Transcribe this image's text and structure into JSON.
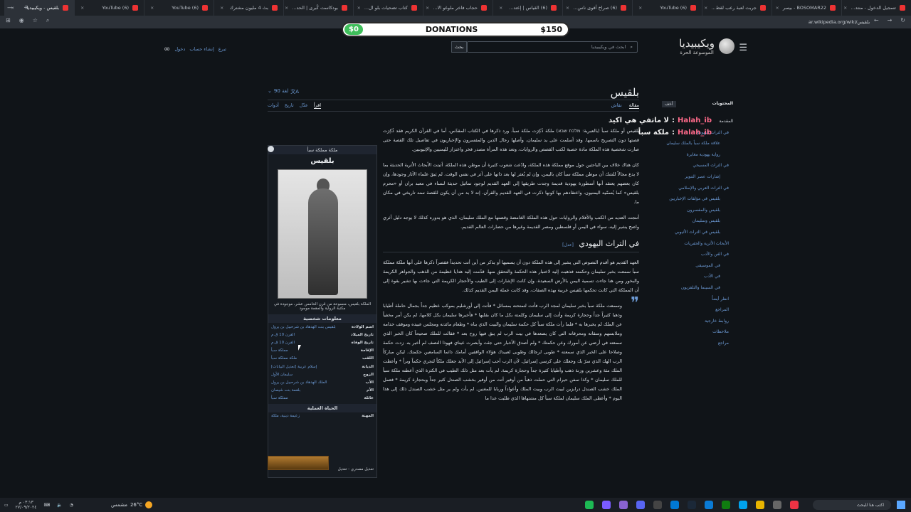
{
  "browser": {
    "tabs": [
      {
        "label": "تسجيل الدخول - منتد..."
      },
      {
        "label": "BOSOMAR22 - بيسر"
      },
      {
        "label": "جربت لعبة رعب لقط..."
      },
      {
        "label": "(6) YouTube"
      },
      {
        "label": "(6) صراخ أقوى ناس..."
      },
      {
        "label": "(6) القياس | إعتد..."
      },
      {
        "label": "حجاب فاخر ملوغو الا..."
      },
      {
        "label": "كتاب تضحيات بلو ال..."
      },
      {
        "label": "بودكاست كُبرى | الحد..."
      },
      {
        "label": "بث 4 مليون مشترك"
      },
      {
        "label": "(6) YouTube"
      },
      {
        "label": "(6) YouTube"
      },
      {
        "label": "بلقيس - ويكيبيديا",
        "active": true
      }
    ],
    "address": "ar.wikipedia.org/wiki/بلقيس"
  },
  "wiki": {
    "logo_title": "ويكيبيديا",
    "logo_sub": "الموسوعة الحرة",
    "search_placeholder": "ابحث في ويكيبيديا",
    "search_button": "بحث",
    "user_links": [
      "تبرع",
      "إنشاء حساب",
      "دخول"
    ],
    "donation": {
      "left": "$0",
      "center": "DONATIONS",
      "right": "$150"
    },
    "title": "بلقيس",
    "lang_count": "90 لغة",
    "tabs_main": [
      "مقالة",
      "نقاش"
    ],
    "tabs_view": [
      "اقرأ",
      "عدّل",
      "تاريخ",
      "أدوات"
    ],
    "toc": {
      "heading": "المحتويات",
      "hide": "أخف",
      "items": [
        {
          "label": "المقدمة",
          "level": 0
        },
        {
          "label": "في التراث اليهودي",
          "level": 1
        },
        {
          "label": "علاقة ملكة سبأ بالملك سليمان",
          "level": 2
        },
        {
          "label": "رواية يهودية مغايرة",
          "level": 2
        },
        {
          "label": "في التراث المسيحي",
          "level": 1
        },
        {
          "label": "إشارات عصر التنوير",
          "level": 2
        },
        {
          "label": "في التراث العربي والإسلامي",
          "level": 1
        },
        {
          "label": "بلقيس في مؤلفات الإخباريين",
          "level": 2
        },
        {
          "label": "بلقيس والمفسرون",
          "level": 2
        },
        {
          "label": "بلقيس وسليمان",
          "level": 2
        },
        {
          "label": "بلقيس في التراث الأثيوبي",
          "level": 2
        },
        {
          "label": "الأبحاث الأثرية والحفريات",
          "level": 1
        },
        {
          "label": "في الفن والأدب",
          "level": 1
        },
        {
          "label": "في الموسيقى",
          "level": 2
        },
        {
          "label": "في الأدب",
          "level": 2
        },
        {
          "label": "في السينما والتلفزيون",
          "level": 2
        },
        {
          "label": "انظر أيضاً",
          "level": 1
        },
        {
          "label": "المراجع",
          "level": 1
        },
        {
          "label": "روابط خارجية",
          "level": 1
        },
        {
          "label": "ملاحظات",
          "level": 1
        },
        {
          "label": "مراجع",
          "level": 1
        }
      ]
    },
    "chat": [
      {
        "nick": "Halah_ib",
        "text": "لا ماتفي هي اكيد"
      },
      {
        "nick": "Halah_ib",
        "text": "ملكة سبأ"
      }
    ],
    "infobox": {
      "header": "ملكة مملكة سبأ",
      "title": "بلقيس",
      "caption": "الملكة بلقيس، منسوخة من قرن الخامس عشر، موجودة في مكتبة الرواية والمقمة موجود",
      "section1": "معلومات شخصية",
      "rows": [
        {
          "k": "اسم الولادة",
          "v": "بلقيس بنت الهدهاد بن شرحبيل بن يرول"
        },
        {
          "k": "تاريخ الميلاد",
          "v": "القرن 10 ق.م"
        },
        {
          "k": "تاريخ الوفاة",
          "v": "القرن 10 ق.م"
        },
        {
          "k": "الإقامة",
          "v": "مملكة سبأ"
        },
        {
          "k": "اللقب",
          "v": "ملكة مملكة سبأ"
        },
        {
          "k": "الديانة",
          "v": "إسلام عربية  [تعديل البيانات]"
        },
        {
          "k": "الزوج",
          "v": "سليمان الأول"
        },
        {
          "k": "الأب",
          "v": "الملك الهدهاد بن شرحبيل بن يرول"
        },
        {
          "k": "الأم",
          "v": "بلقمة بنت شيصان"
        },
        {
          "k": "عائلة",
          "v": "مملكة سبأ"
        }
      ],
      "section2": "الحياة العملية",
      "rows2": [
        {
          "k": "المهنة",
          "v": "زعيمة دينية، ملكة"
        }
      ],
      "footer": "تعديل مصدري - تعديل"
    },
    "article": {
      "p1": "بلقيس أو ملكة سبأ (بالعبرية: מלכת שבא) ملكة ذُكِرَت ملكة سبأ، ورد ذكرها في الكتاب المقدّس، أما في القرآن الكريم فقد ذُكِرَت قصتها دون التصريح باسمها. وقد أسلمت على يد سليمان، وأصلها رجال الدين والمفسرون والإخباريون في تفاصيل تلك القصة حتى صارت شخصية هذه الملكة مادة خصبة لكتب القصص والروايات، وتعد هذه المرأة مصدر فخر واعتزاز لليمنيين والإثيوبيين.",
      "p2": "كان هناك خلاف بين الباحثين حول موقع مملكة هذه الملكة، وادّعت شعوب كثيرة أن موطن هذه الملكة، أثبتت الأبحاث الأثرية الحديثة بما لا يدع مجالاً للشك أن موطن مملكة سبأ كان باليمن، وإن لم يُعثر لها بعد ذاتها على أثر في نفس الوقت. لم يَبقَ علماء الآثار وجودها، وإن كان بعضهم يعتقد أنها أسطورة يهودية قديمة وجدت طريقها إلى العهد القديم لوجود تماثيل حديثة لنساء في معبد بران أو «محرم بلقيس» كما يُسمّيه اليمنيون، واعتقادهم بها كونها ذكرت في العهد القديم والقرآن. إنه لا بد من أن يكون للقصة سند تاريخي في مكان ما.",
      "p3": "أنتجت العديد من الكتب والأفلام والروايات حول هذه الملكة الغامضة وقصتها مع الملك سليمان، الذي هو بدوره كذلك لا يوجد دليل أثري واضح يشير إليه، سواء في اليمن أو فلسطين ومصر القديمة وغيرها من حضارات العالم القديم.",
      "h2": "في التراث اليهودي",
      "edit": "[عدل]",
      "p4": "العهد القديم هو أقدم النصوص التي يشير إلى هذه الملكة دون أن يسميها أو يذكر من أين أتت تحديداً فقصراً ذكرها على أنها ملكة مملكة سبأ سمعت بخبر سليمان وحكمته فذهبت إليه لاختبار هذه الحكمة والتحقق منها. قدّمت إليه هدايا عظيمة من الذهب والجواهر الكريمة والبخور ومن هنا جاءت تسمية اليمن بالأرض السعيدة، وإن كانت الإشارات إلى الطيب والأحجار الكريمة التي جاءت بها تشير بقوة إلى أن المملكة التي كانت تحكمها بلقيس عربية بهذه الصفات، وقد كانت عملة اليمن القديم كذلك.",
      "quote": "وسمعت ملكة سبأ بخبر سليمان لمجد الرب فأتت لتمتحنه بمسائل * فأتت إلى أورشليم بموكب عظيم جداً بجمال حاملة أطيابا وذهبا كثيراً جداً وحجارة كريمة وأتت إلى سليمان وكلمته بكل ما كان بقلبها * فأخبرها سليمان بكل كلامها، لم يكن أمر مخفياً عن الملك لم يخبرها به * فلما رأت ملكة سبأ كل حكمة سليمان والبيت الذي بناه * وطعام مائدته ومجلس عبيده وموقف خدامه وملابسهم وسقاته ومحرقاته التي كان يصعدها في بيت الرب لم يبق فيها روح بعد * فقالت للملك صحيحاً كان الخبر الذي سمعته في أرضي عن أمورك وعن حكمتك * ولم أصدق الأخبار حتى جئت وأبصرت عيناي فهوذا النصف لم أخبر به. زدت حكمة وصلاحا على الخبر الذي سمعته * طوبى لرجالك وطوبى لعبيدك هؤلاء الواقفين أمامك دائما السامعين حكمتك. ليكن مباركاً الرب الهك الذي سرّ بك وجعلك على كرسي إسرائيل. لأن الرب أحب إسرائيل إلى الأبد جعلك ملكاً لتجري حكماً وبراً * وأعطت الملك مئة وعشرين وزنة ذهب وأطيابا كثيرة جداً وحجارة كريمة. لم يأت بعد مثل ذلك الطيب في الكثرة الذي أعطته ملكة سبأ للملك سليمان * وكذا سفن حيرام التي حملت ذهباً من أوفير أتت من أوفير بخشب الصندل كثير جداً وبحجارة كريمة * فعمل الملك خشب الصندل درابزين لبيت الرب وبيت الملك وأعواداً وربابا للمغنين. لم يأت ولم ير مثل خشب الصندل ذلك إلى هذا اليوم * وأعطى الملك سليمان لملكة سبأ كل مشتهاها الذي طلبت عدا ما"
    }
  },
  "taskbar": {
    "time": "٠٣:١٣ م",
    "date": "٢٧/٠٩/٢٠٢٤",
    "weather": "26°C",
    "weather_label": "مشمس",
    "search": "اكتب هنا للبحث"
  }
}
